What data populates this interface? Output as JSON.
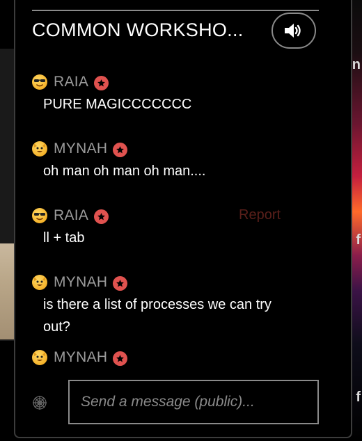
{
  "chat": {
    "title": "COMMON WORKSHO...",
    "messages": [
      {
        "user": "RAIA",
        "avatar": "sunglasses-face-emoji",
        "text": "PURE MAGICCCCCCC"
      },
      {
        "user": "MYNAH",
        "avatar": "cat-face-emoji",
        "text": "oh man oh man oh man...."
      },
      {
        "user": "RAIA",
        "avatar": "sunglasses-face-emoji",
        "text": "ll + tab"
      },
      {
        "user": "MYNAH",
        "avatar": "cat-face-emoji",
        "text": "is there a list of processes we can try out?"
      },
      {
        "user": "MYNAH",
        "avatar": "cat-face-emoji",
        "text": ""
      }
    ],
    "report_label": "Report",
    "input_placeholder": "Send a message (public)...",
    "badge_icon": "star-badge-icon",
    "sound_icon": "speaker-icon",
    "settings_icon": "web-icon"
  },
  "colors": {
    "badge": "#e0524f",
    "username": "#9b9b9b",
    "report": "#5a1f1a",
    "border": "#8a8a8a"
  },
  "background": {
    "right_chars": [
      "n",
      "f",
      "f"
    ]
  }
}
